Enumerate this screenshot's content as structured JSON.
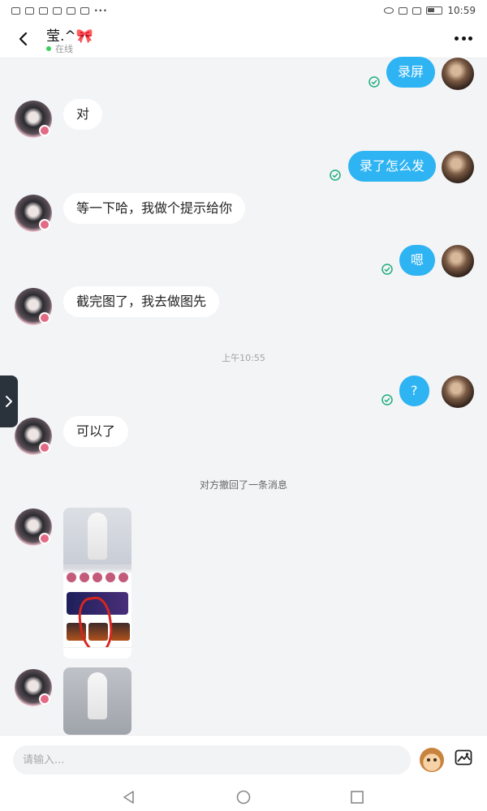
{
  "status_bar": {
    "more_dots": "···",
    "time": "10:59"
  },
  "header": {
    "contact_name": "莹.^🎀",
    "presence": "在线"
  },
  "messages": [
    {
      "type": "out",
      "text": "录屏"
    },
    {
      "type": "in",
      "text": "对"
    },
    {
      "type": "out",
      "text": "录了怎么发"
    },
    {
      "type": "in",
      "text": "等一下哈，我做个提示给你"
    },
    {
      "type": "out",
      "text": "嗯"
    },
    {
      "type": "in",
      "text": "截完图了，我去做图先"
    },
    {
      "type": "time",
      "text": "上午10:55"
    },
    {
      "type": "out",
      "text": "?"
    },
    {
      "type": "in",
      "text": "可以了"
    },
    {
      "type": "system",
      "text": "对方撤回了一条消息"
    },
    {
      "type": "in_image"
    },
    {
      "type": "in_image"
    }
  ],
  "input": {
    "placeholder": "请输入..."
  },
  "icons": {
    "back": "back-arrow-icon",
    "more": "more-options-icon",
    "read": "read-check-icon",
    "emoji": "emoji-icon",
    "image": "image-icon",
    "nav_back": "nav-back-icon",
    "nav_home": "nav-home-icon",
    "nav_recent": "nav-recents-icon"
  },
  "colors": {
    "outgoing_bubble": "#2eb3f3",
    "read_check": "#1fae7a",
    "online_dot": "#3ccf5a"
  }
}
